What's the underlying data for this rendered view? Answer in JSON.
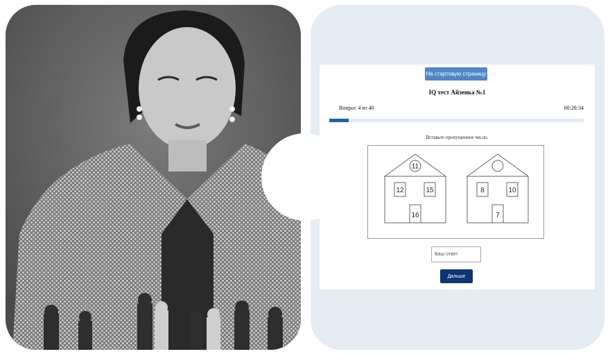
{
  "colors": {
    "accent": "#1d5fb3",
    "home_button_bg": "#4f87c7",
    "next_button_bg": "#0f3374",
    "panel_bg": "#e6ecf3"
  },
  "photo": {
    "icon": "woman-playing-chess-photo"
  },
  "quiz": {
    "home_button": "На стартовую страницу",
    "title": "IQ тест Айзенка №1",
    "question_counter": "Вопрос 4 из 40",
    "timer": "00:28:34",
    "progress": 0.075,
    "prompt": "Вставьте пропущенное число.",
    "answer_placeholder": "Ваш ответ",
    "next_button": "Дальше",
    "houses": [
      {
        "roof": "11",
        "windows": [
          "12",
          "15"
        ],
        "door": "16"
      },
      {
        "roof": "",
        "windows": [
          "8",
          "10"
        ],
        "door": "7"
      }
    ]
  }
}
